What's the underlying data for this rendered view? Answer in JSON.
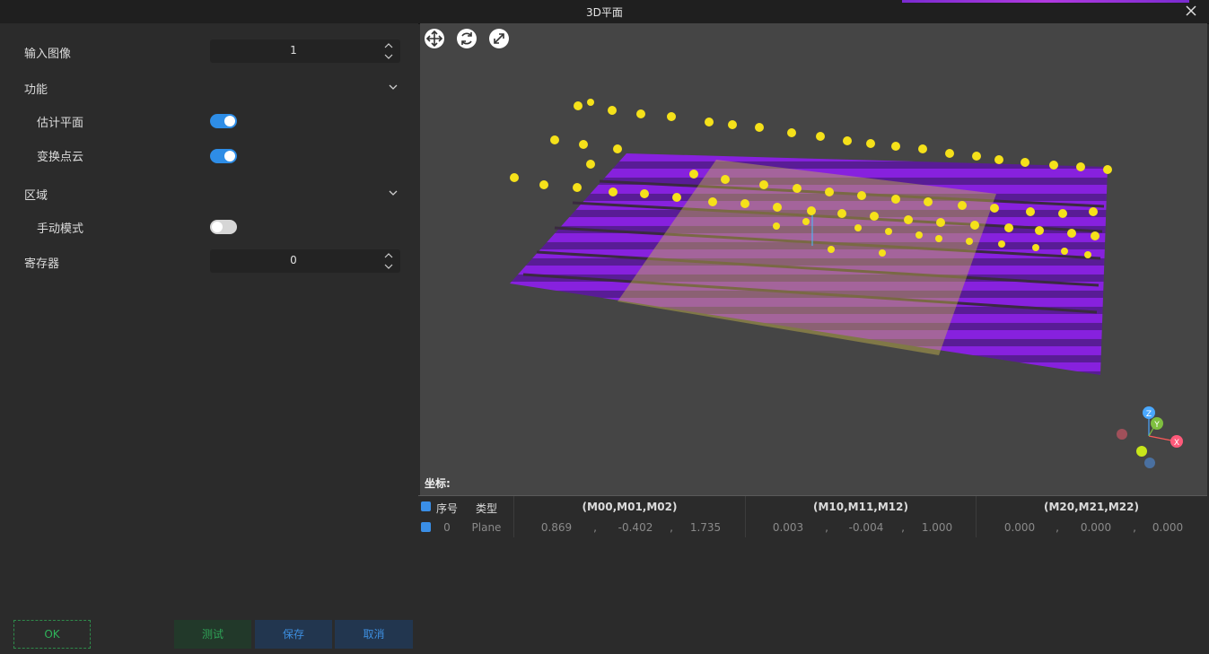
{
  "window": {
    "title": "3D平面"
  },
  "panel": {
    "input_image_label": "输入图像",
    "input_image_value": "1",
    "function_label": "功能",
    "estimate_plane_label": "估计平面",
    "estimate_plane_on": true,
    "transform_cloud_label": "变换点云",
    "transform_cloud_on": true,
    "region_label": "区域",
    "manual_mode_label": "手动模式",
    "manual_mode_on": false,
    "register_label": "寄存器",
    "register_value": "0"
  },
  "buttons": {
    "ok": "OK",
    "test": "测试",
    "save": "保存",
    "cancel": "取消"
  },
  "viewer": {
    "tools": [
      "move-icon",
      "rotate-icon",
      "fit-icon"
    ],
    "axes": {
      "x": "X",
      "y": "Y",
      "z": "Z"
    }
  },
  "coords": {
    "label": "坐标:",
    "headers": {
      "index": "序号",
      "type": "类型",
      "m0": "(M00,M01,M02)",
      "m1": "(M10,M11,M12)",
      "m2": "(M20,M21,M22)"
    },
    "rows": [
      {
        "index": "0",
        "type": "Plane",
        "m0": [
          "0.869",
          "-0.402",
          "1.735"
        ],
        "m1": [
          "0.003",
          "-0.004",
          "1.000"
        ],
        "m2": [
          "0.000",
          "0.000",
          "0.000"
        ],
        "sep": ","
      }
    ]
  },
  "colors": {
    "accent": "#2e8de6",
    "ok_green": "#2fb35a",
    "cloud_purple": "#8a1fe6",
    "cloud_yellow": "#f5e11a"
  }
}
